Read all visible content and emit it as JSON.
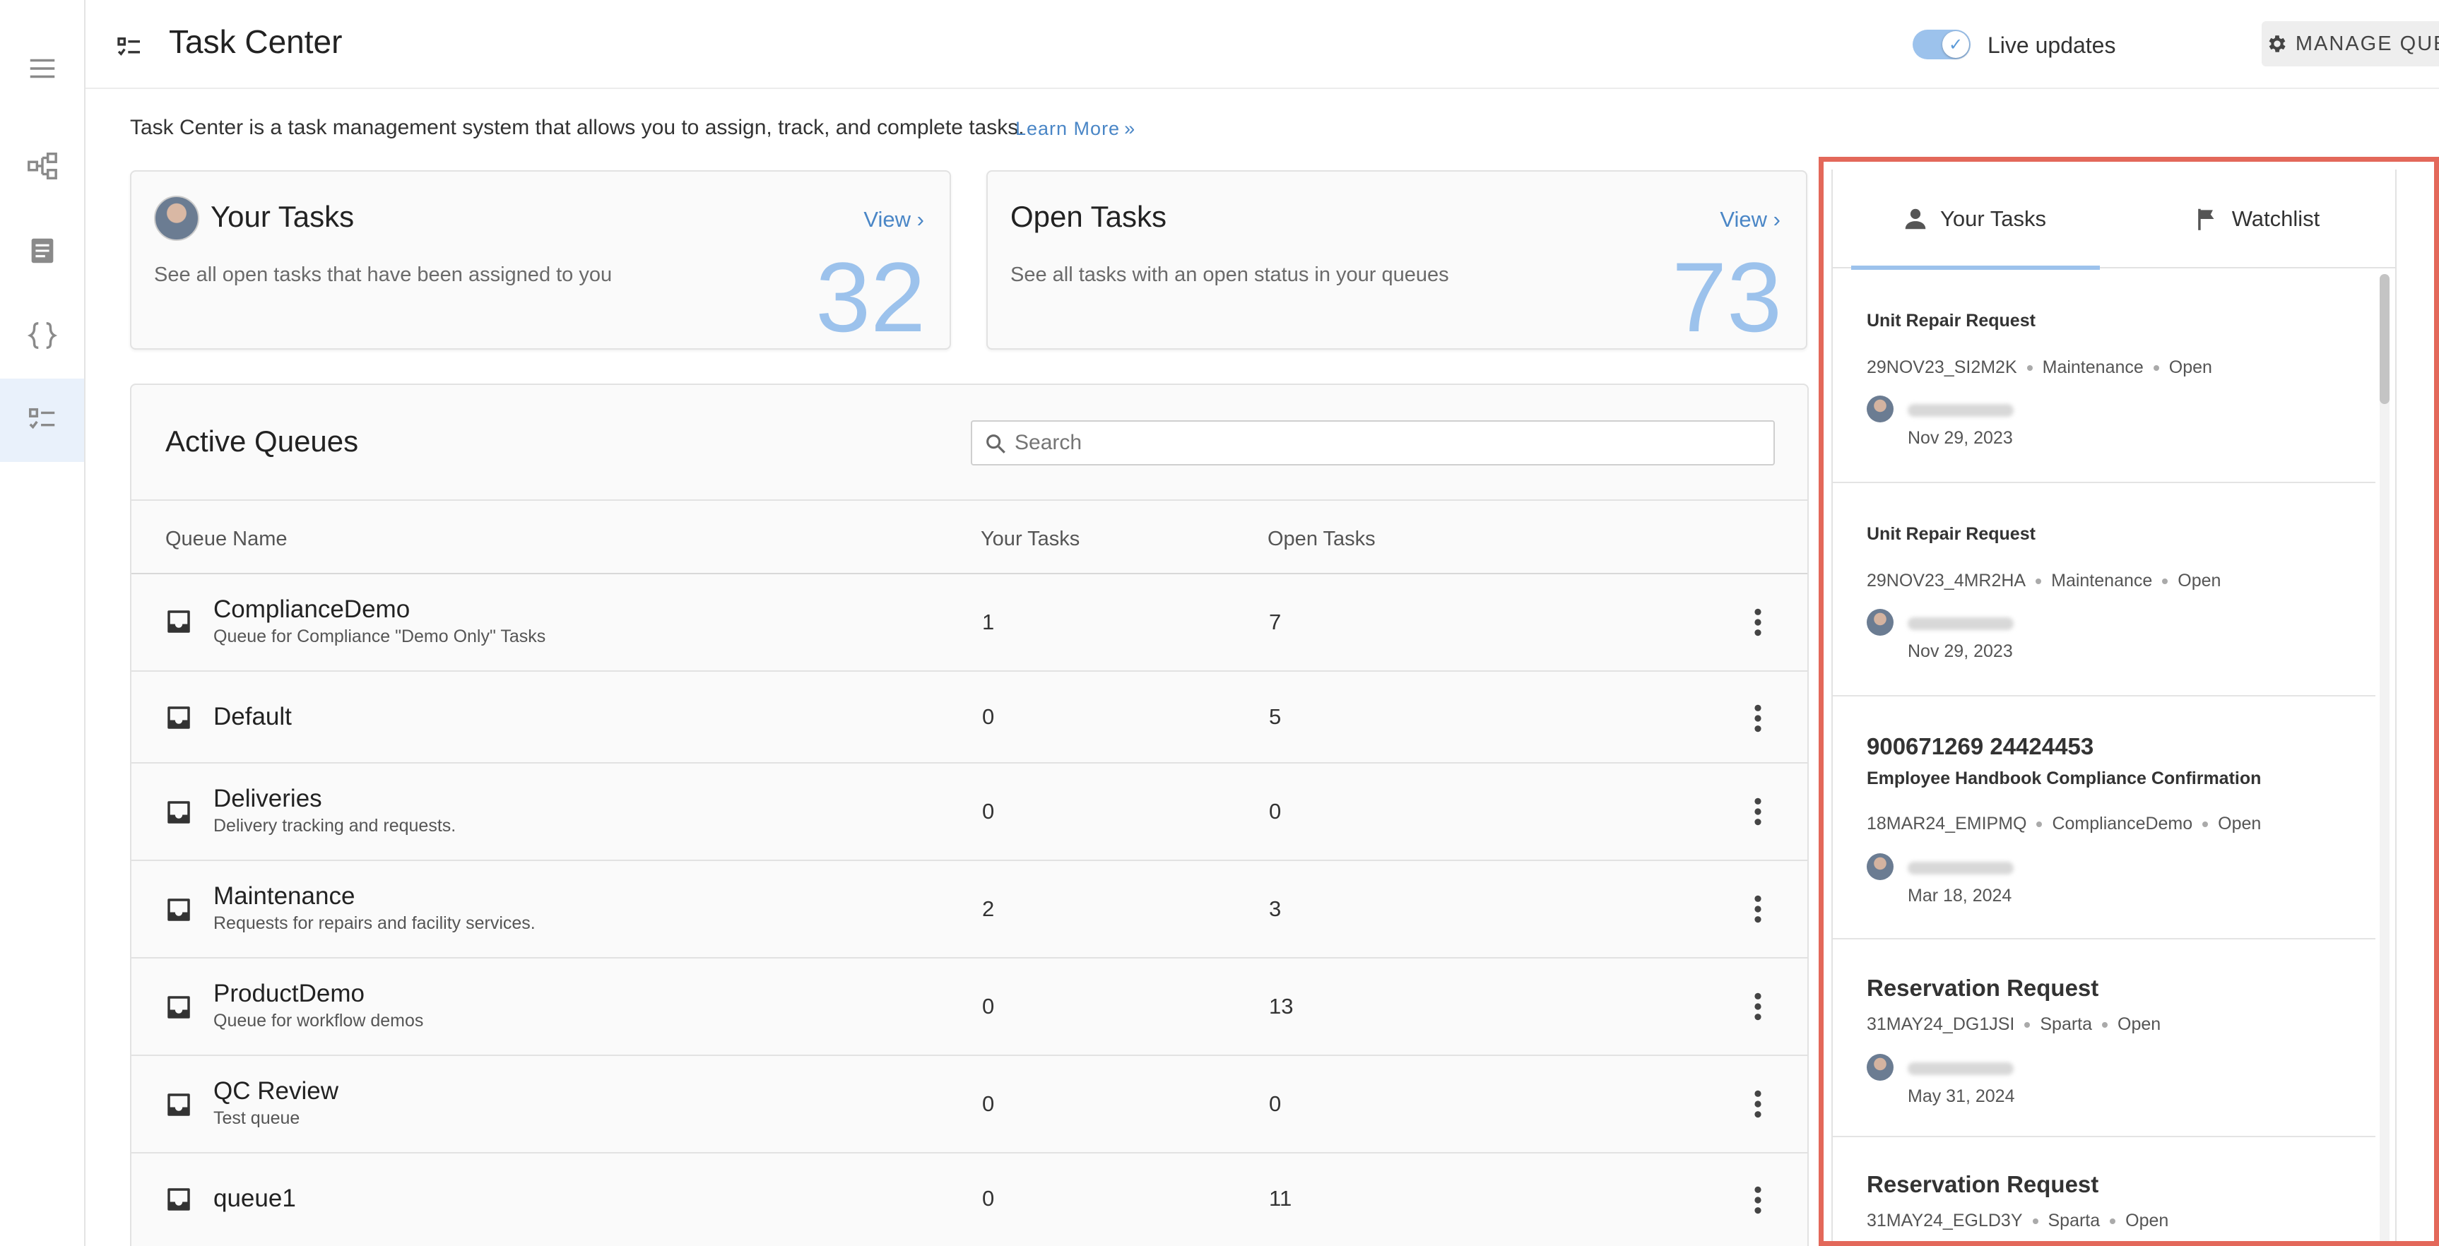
{
  "header": {
    "title": "Task Center",
    "live_updates_label": "Live updates",
    "manage_queues_label": "MANAGE QUEUES"
  },
  "intro": {
    "text": "Task Center is a task management system that allows you to assign, track, and complete tasks.",
    "learn_more": "Learn More"
  },
  "cards": {
    "your_tasks": {
      "title": "Your Tasks",
      "view": "View",
      "description": "See all open tasks that have been assigned to you",
      "count": "32"
    },
    "open_tasks": {
      "title": "Open Tasks",
      "view": "View",
      "description": "See all tasks with an open status in your queues",
      "count": "73"
    }
  },
  "queues": {
    "title": "Active Queues",
    "search_placeholder": "Search",
    "columns": [
      "Queue Name",
      "Your Tasks",
      "Open Tasks"
    ],
    "rows": [
      {
        "name": "ComplianceDemo",
        "description": "Queue for Compliance \"Demo Only\" Tasks",
        "your_tasks": "1",
        "open_tasks": "7"
      },
      {
        "name": "Default",
        "description": "",
        "your_tasks": "0",
        "open_tasks": "5"
      },
      {
        "name": "Deliveries",
        "description": "Delivery tracking and requests.",
        "your_tasks": "0",
        "open_tasks": "0"
      },
      {
        "name": "Maintenance",
        "description": "Requests for repairs and facility services.",
        "your_tasks": "2",
        "open_tasks": "3"
      },
      {
        "name": "ProductDemo",
        "description": "Queue for workflow demos",
        "your_tasks": "0",
        "open_tasks": "13"
      },
      {
        "name": "QC Review",
        "description": "Test queue",
        "your_tasks": "0",
        "open_tasks": "0"
      },
      {
        "name": "queue1",
        "description": "",
        "your_tasks": "0",
        "open_tasks": "11"
      }
    ]
  },
  "side_panel": {
    "tabs": [
      {
        "label": "Your Tasks",
        "icon": "person-icon",
        "active": true
      },
      {
        "label": "Watchlist",
        "icon": "flag-icon",
        "active": false
      }
    ],
    "tasks": [
      {
        "heading": "",
        "title": "Unit Repair Request",
        "id": "29NOV23_SI2M2K",
        "queue": "Maintenance",
        "status": "Open",
        "date": "Nov 29, 2023"
      },
      {
        "heading": "",
        "title": "Unit Repair Request",
        "id": "29NOV23_4MR2HA",
        "queue": "Maintenance",
        "status": "Open",
        "date": "Nov 29, 2023"
      },
      {
        "heading": "900671269 24424453",
        "title": "Employee Handbook Compliance Confirmation",
        "id": "18MAR24_EMIPMQ",
        "queue": "ComplianceDemo",
        "status": "Open",
        "date": "Mar 18, 2024"
      },
      {
        "heading": "Reservation Request",
        "title": "",
        "id": "31MAY24_DG1JSI",
        "queue": "Sparta",
        "status": "Open",
        "date": "May 31, 2024"
      },
      {
        "heading": "Reservation Request",
        "title": "",
        "id": "31MAY24_EGLD3Y",
        "queue": "Sparta",
        "status": "Open",
        "date": ""
      }
    ]
  },
  "colors": {
    "accent": "#4a86c6",
    "count": "#9cc2ec",
    "highlight_border": "#e3685a",
    "rail_active": "#e9f1fb"
  }
}
